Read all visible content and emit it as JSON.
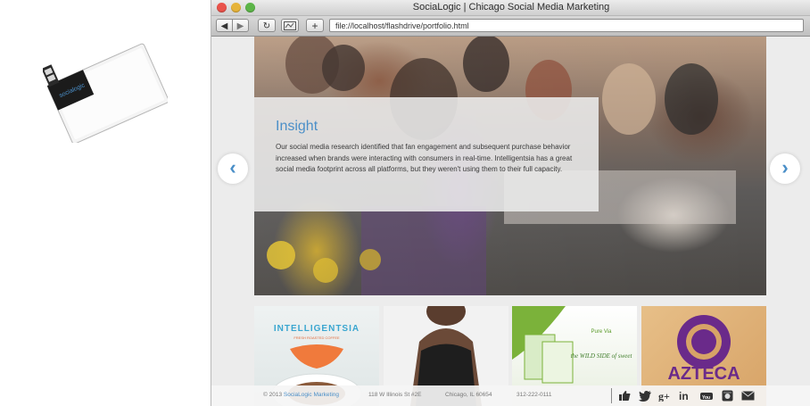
{
  "window": {
    "title": "SociaLogic | Chicago Social Media Marketing",
    "address": "file://localhost/flashdrive/portfolio.html"
  },
  "toolbar": {
    "back_icon": "◀",
    "forward_icon": "▶",
    "reload_icon": "↻",
    "add_icon": "+"
  },
  "flashdrive": {
    "logo_text": "socialogic"
  },
  "hero": {
    "heading": "Insight",
    "body": "Our social media research identified that fan engagement and subsequent purchase behavior increased when brands were interacting with consumers in real-time. Intelligentsia has a great social media footprint across all platforms, but they weren't using them to their full capacity.",
    "prev_icon": "‹",
    "next_icon": "›"
  },
  "thumbnails": [
    {
      "name": "intelligentsia",
      "brand_text": "INTELLIGENTSIA",
      "sub_text": "FRESH ROASTED COFFEE"
    },
    {
      "name": "mcdavid",
      "brand_text": ""
    },
    {
      "name": "purevia",
      "brand_text": "the WILD SIDE of sweet",
      "logo_text": "Pure Via"
    },
    {
      "name": "azteca",
      "brand_text": "AZTECA"
    }
  ],
  "footer": {
    "copyright_prefix": "© 2013 ",
    "copyright_link": "SociaLogic Marketing",
    "address": "118 W Illinois St #2E",
    "city": "Chicago, IL 60654",
    "phone": "312-222-0111"
  },
  "social_icons": [
    "like-icon",
    "twitter-icon",
    "google-plus-icon",
    "linkedin-icon",
    "youtube-icon",
    "instagram-icon",
    "mail-icon"
  ],
  "colors": {
    "accent": "#4b8fc8",
    "traffic_red": "#e9524a",
    "traffic_yellow": "#e6b33a",
    "traffic_green": "#5cb548"
  }
}
